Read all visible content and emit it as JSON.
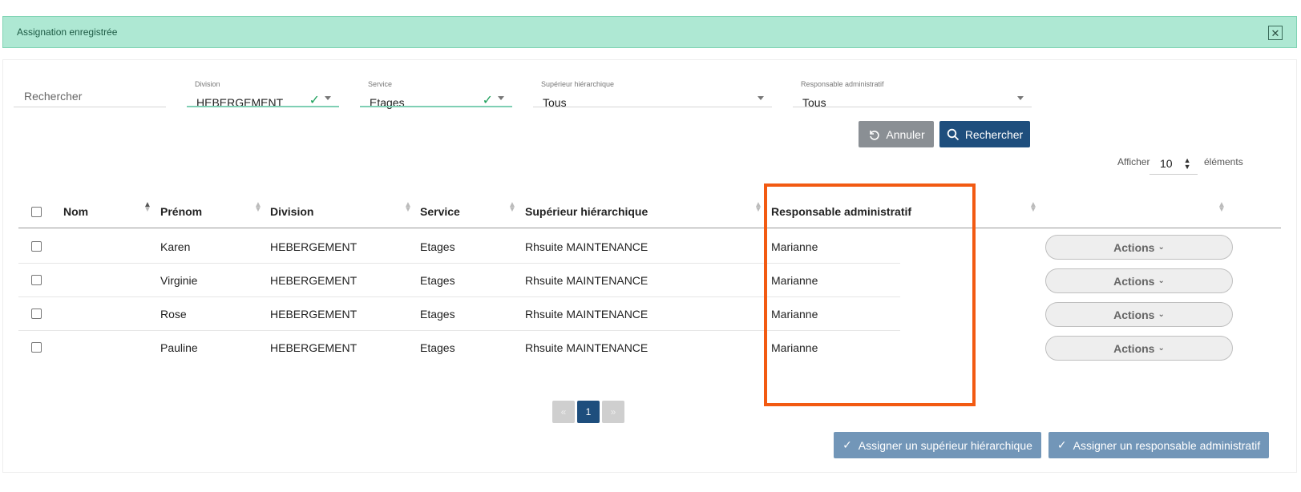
{
  "alert": {
    "message": "Assignation enregistrée",
    "close": "✕"
  },
  "filters": {
    "search": {
      "placeholder": "Rechercher"
    },
    "division": {
      "label": "Division",
      "value": "HEBERGEMENT"
    },
    "service": {
      "label": "Service",
      "value": "Etages"
    },
    "superieur": {
      "label": "Supérieur hiérarchique",
      "value": "Tous"
    },
    "responsable": {
      "label": "Responsable administratif",
      "value": "Tous"
    }
  },
  "buttons": {
    "cancel": "Annuler",
    "search": "Rechercher"
  },
  "paging": {
    "afficher": "Afficher",
    "size": "10",
    "elements": "éléments",
    "current": "1",
    "prev": "«",
    "next": "»"
  },
  "table": {
    "headers": [
      "Nom",
      "Prénom",
      "Division",
      "Service",
      "Supérieur hiérarchique",
      "Responsable administratif"
    ],
    "rows": [
      {
        "nom": "",
        "prenom": "Karen",
        "division": "HEBERGEMENT",
        "service": "Etages",
        "superieur": "Rhsuite MAINTENANCE",
        "responsable": "Marianne"
      },
      {
        "nom": "",
        "prenom": "Virginie",
        "division": "HEBERGEMENT",
        "service": "Etages",
        "superieur": "Rhsuite MAINTENANCE",
        "responsable": "Marianne"
      },
      {
        "nom": "",
        "prenom": "Rose",
        "division": "HEBERGEMENT",
        "service": "Etages",
        "superieur": "Rhsuite MAINTENANCE",
        "responsable": "Marianne"
      },
      {
        "nom": "",
        "prenom": "Pauline",
        "division": "HEBERGEMENT",
        "service": "Etages",
        "superieur": "Rhsuite MAINTENANCE",
        "responsable": "Marianne"
      }
    ],
    "actions_label": "Actions"
  },
  "assign": {
    "superieur": "Assigner un supérieur hiérarchique",
    "responsable": "Assigner un responsable administratif"
  },
  "colors": {
    "alert_bg": "#aee8d3",
    "primary": "#1e4e7d",
    "highlight": "#f25a12",
    "valid": "#1fa15d"
  },
  "icons": [
    "close-icon",
    "check-icon",
    "chevron-down-icon",
    "undo-icon",
    "search-icon",
    "sort-icon"
  ]
}
